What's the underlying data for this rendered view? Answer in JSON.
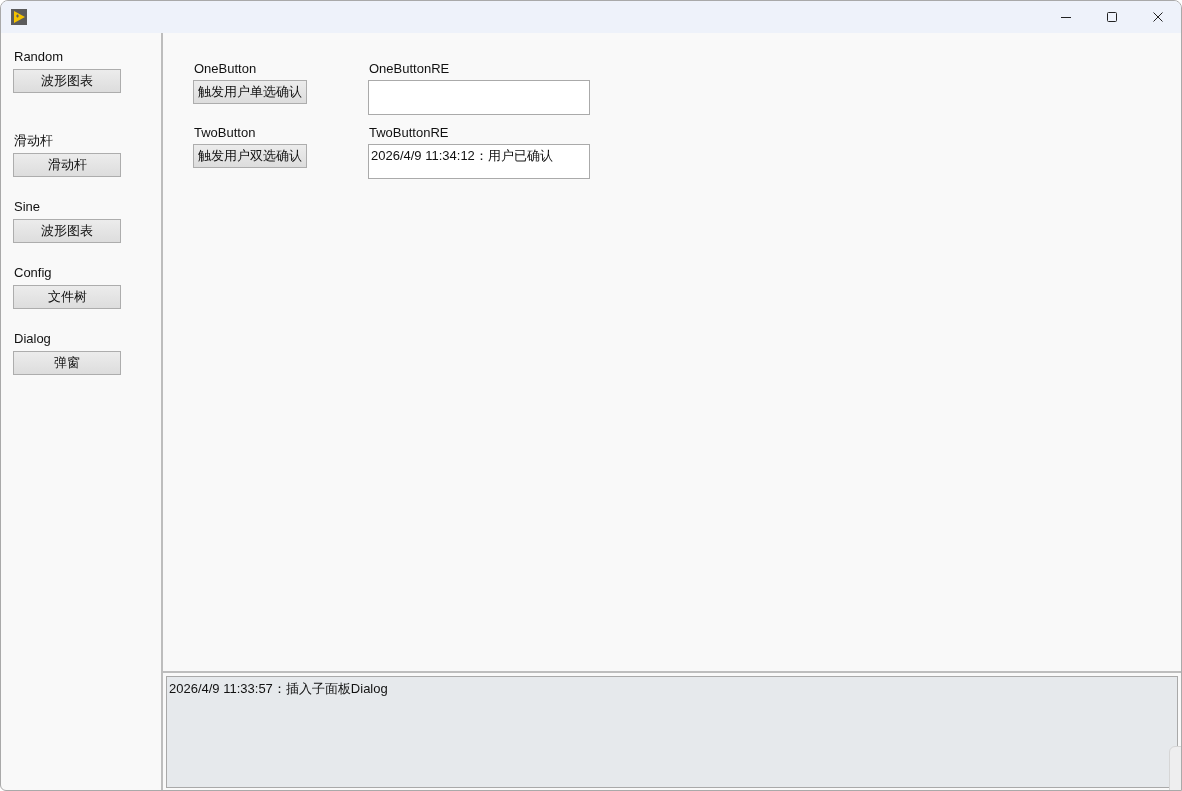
{
  "sidebar": {
    "items": [
      {
        "label": "Random",
        "button": "波形图表"
      },
      {
        "label": "滑动杆",
        "button": "滑动杆"
      },
      {
        "label": "Sine",
        "button": "波形图表"
      },
      {
        "label": "Config",
        "button": "文件树"
      },
      {
        "label": "Dialog",
        "button": "弹窗"
      }
    ]
  },
  "panel": {
    "rows": [
      {
        "control": {
          "label": "OneButton",
          "button": "触发用户单选确认"
        },
        "indicator": {
          "label": "OneButtonRE"
        }
      },
      {
        "control": {
          "label": "TwoButton",
          "button": "触发用户双选确认"
        },
        "indicator": {
          "label": "TwoButtonRE",
          "value": "2026/4/9 11:34:12：用户已确认"
        }
      }
    ]
  },
  "log": {
    "text": "2026/4/9 11:33:57：插入子面板Dialog"
  }
}
